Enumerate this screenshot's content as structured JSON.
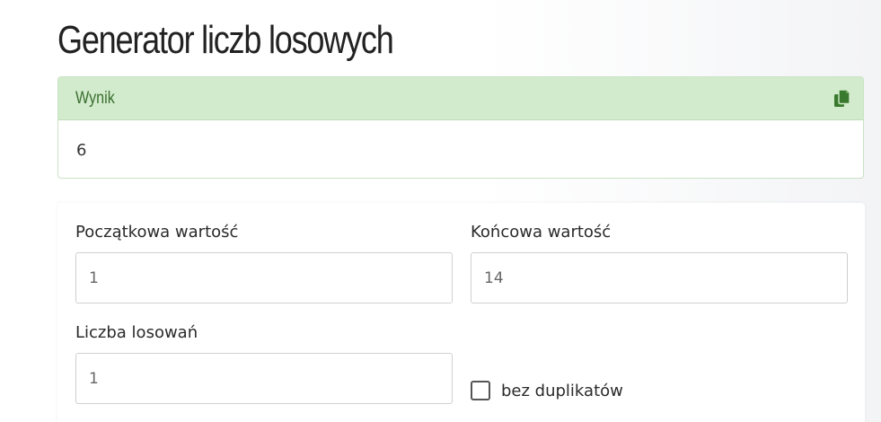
{
  "page": {
    "title": "Generator liczb losowych"
  },
  "result": {
    "header_label": "Wynik",
    "value": "6",
    "copy_icon": "copy-icon",
    "header_color": "#d3ebcd",
    "header_text_color": "#3a6e2f"
  },
  "form": {
    "start": {
      "label": "Początkowa wartość",
      "value": "1"
    },
    "end": {
      "label": "Końcowa wartość",
      "value": "14"
    },
    "count": {
      "label": "Liczba losowań",
      "value": "1"
    },
    "no_duplicates": {
      "label": "bez duplikatów",
      "checked": false
    }
  }
}
